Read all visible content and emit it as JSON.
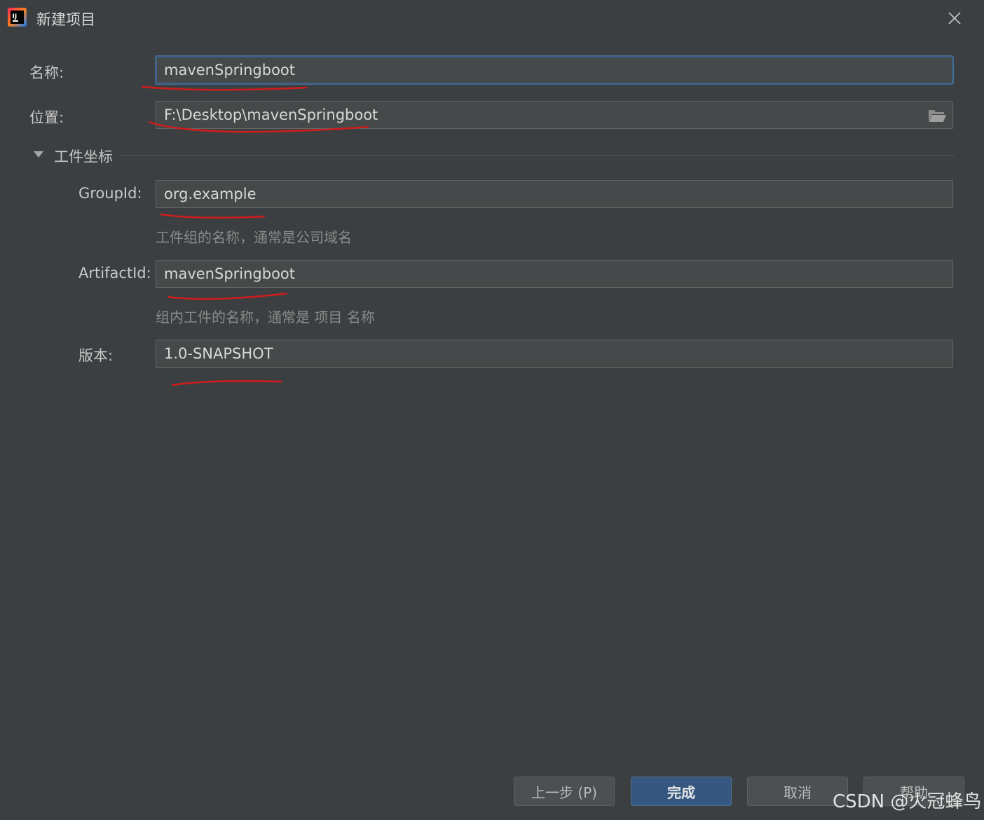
{
  "window": {
    "title": "新建项目"
  },
  "form": {
    "name_label": "名称:",
    "name_value": "mavenSpringboot",
    "location_label": "位置:",
    "location_value": "F:\\Desktop\\mavenSpringboot",
    "section_title": "工件坐标",
    "group_label": "GroupId:",
    "group_value": "org.example",
    "group_hint": "工件组的名称，通常是公司域名",
    "artifact_label": "ArtifactId:",
    "artifact_value": "mavenSpringboot",
    "artifact_hint": "组内工件的名称，通常是 项目 名称",
    "version_label": "版本:",
    "version_value": "1.0-SNAPSHOT"
  },
  "buttons": {
    "previous": "上一步 (P)",
    "finish": "完成",
    "cancel": "取消",
    "help": "帮助"
  },
  "watermark": "CSDN @火冠蜂鸟",
  "colors": {
    "background": "#3c3f41",
    "field_bg": "#45494a",
    "focus_border": "#3d6185",
    "primary_button": "#365880",
    "annotation_red": "#d01c1c"
  },
  "icons": {
    "app": "intellij-idea-icon",
    "close": "close-icon",
    "folder": "folder-open-icon",
    "toggle": "triangle-down-icon"
  }
}
